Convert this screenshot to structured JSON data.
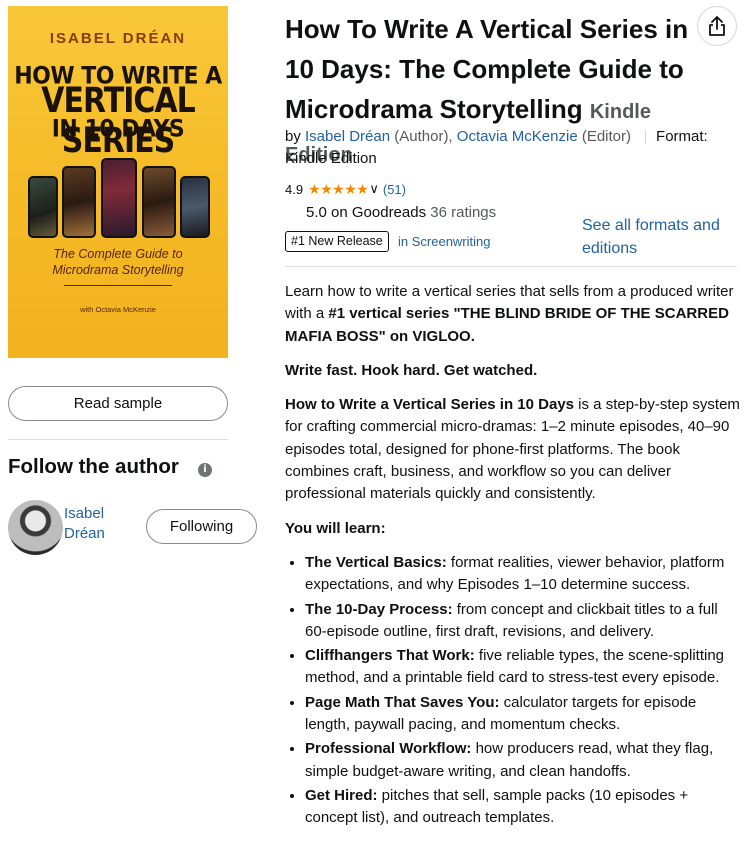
{
  "cover": {
    "author": "ISABEL DRÉAN",
    "title_line1": "HOW TO WRITE A",
    "title_line2": "VERTICAL SERIES",
    "title_line3": "IN 10 DAYS",
    "subtitle_line1": "The Complete Guide to",
    "subtitle_line2": "Microdrama Storytelling",
    "with": "with Octavia McKenzie"
  },
  "left": {
    "read_sample_label": "Read sample",
    "follow_title": "Follow the author",
    "info_icon": "i",
    "author_name": "Isabel Dréan",
    "following_label": "Following"
  },
  "product": {
    "title": "How To Write A Vertical Series in 10 Days: The Complete Guide to Microdrama Storytelling",
    "edition": "Kindle Edition",
    "by": "by",
    "author1": "Isabel Dréan",
    "author1_role": "(Author),",
    "author2": "Octavia McKenzie",
    "author2_role": "(Editor)",
    "format_label": "Format:",
    "format_value": "Kindle Edition",
    "rating": "4.9",
    "stars": "★★★★★",
    "rating_count": "(51)",
    "goodreads_rating": "5.0 on Goodreads",
    "goodreads_count": "36 ratings",
    "badge": "#1 New Release",
    "badge_category": "in Screenwriting",
    "formats_link": "See all formats and editions"
  },
  "description": {
    "p1_a": "Learn how to write a vertical series that sells from a produced writer with a ",
    "p1_b": "#1 vertical series \"THE BLIND BRIDE OF THE SCARRED MAFIA BOSS\" on VIGLOO.",
    "p2": "Write fast. Hook hard. Get watched.",
    "p3_bold": "How to Write a Vertical Series in 10 Days",
    "p3_rest": " is a step-by-step system for crafting commercial micro-dramas: 1–2 minute episodes, 40–90 episodes total, designed for phone-first platforms. The book combines craft, business, and workflow so you can deliver professional materials quickly and consistently.",
    "learn_heading": "You will learn:",
    "items": [
      {
        "head": "The Vertical Basics:",
        "body": " format realities, viewer behavior, platform expectations, and why Episodes 1–10 determine success."
      },
      {
        "head": "The 10-Day Process:",
        "body": " from concept and clickbait titles to a full 60-episode outline, first draft, revisions, and delivery."
      },
      {
        "head": "Cliffhangers That Work:",
        "body": " five reliable types, the scene-splitting method, and a printable field card to stress-test every episode."
      },
      {
        "head": "Page Math That Saves You:",
        "body": " calculator targets for episode length, paywall pacing, and momentum checks."
      },
      {
        "head": "Professional Workflow:",
        "body": " how producers read, what they flag, simple budget-aware writing, and clean handoffs."
      },
      {
        "head": "Get Hired:",
        "body": " pitches that sell, sample packs (10 episodes + concept list), and outreach templates."
      }
    ]
  },
  "colors": {
    "link": "#2162a1",
    "star": "#f08804",
    "cover_bg": "#f6bd2a"
  },
  "icons": {
    "share": "share-icon",
    "info": "info-icon",
    "chevron": "chevron-down-icon"
  }
}
